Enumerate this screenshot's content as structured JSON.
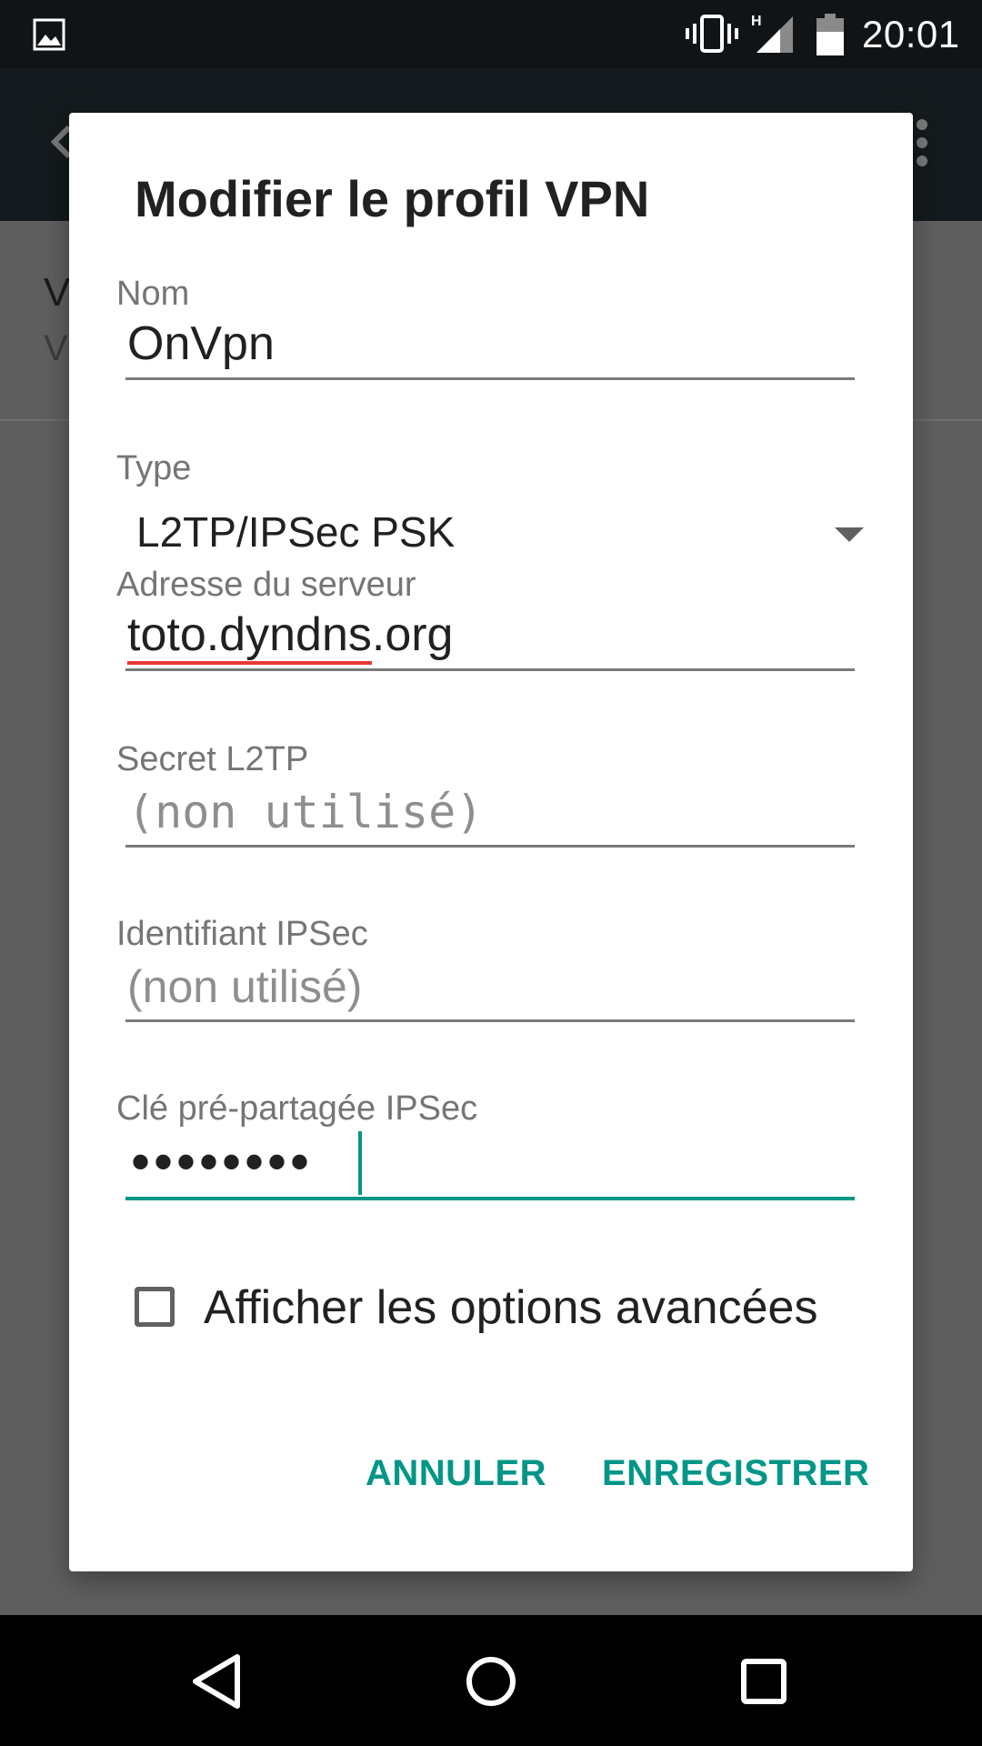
{
  "status_bar": {
    "time": "20:01",
    "network_type": "H",
    "icons": [
      "gallery-icon",
      "vibrate-icon",
      "signal-icon",
      "battery-icon"
    ]
  },
  "background": {
    "item_title_fragment": "V",
    "item_subtitle_fragment": "V"
  },
  "dialog": {
    "title": "Modifier le profil VPN",
    "fields": {
      "name": {
        "label": "Nom",
        "value": "OnVpn"
      },
      "type": {
        "label": "Type",
        "value": "L2TP/IPSec PSK"
      },
      "server": {
        "label": "Adresse du serveur",
        "value_misspelled_part": "toto.dyndns",
        "value_rest": ".org"
      },
      "l2tp_secret": {
        "label": "Secret L2TP",
        "placeholder": "(non utilisé)"
      },
      "ipsec_id": {
        "label": "Identifiant IPSec",
        "placeholder": "(non utilisé)"
      },
      "ipsec_psk": {
        "label": "Clé pré-partagée IPSec",
        "masked_value": "••••••••"
      }
    },
    "advanced_options": {
      "label": "Afficher les options avancées",
      "checked": false
    },
    "buttons": {
      "cancel": "ANNULER",
      "save": "ENREGISTRER"
    }
  },
  "colors": {
    "accent": "#009688",
    "spellcheck": "#e53935",
    "status_bar": "#111417",
    "scrim": "#5f5f5f"
  }
}
